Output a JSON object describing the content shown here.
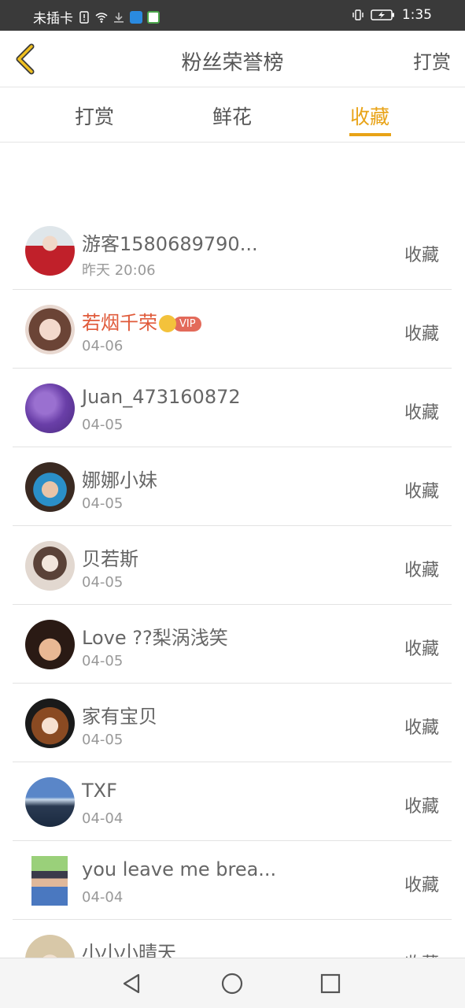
{
  "status_bar": {
    "carrier": "未插卡",
    "time": "1:35",
    "icons": [
      "sim-alert-icon",
      "wifi-icon",
      "download-icon",
      "app-icon",
      "app-icon",
      "vibrate-icon",
      "battery-charging-icon"
    ]
  },
  "header": {
    "title": "粉丝荣誉榜",
    "action_label": "打赏",
    "back_icon": "chevron-left-icon"
  },
  "tabs": [
    {
      "label": "打赏",
      "active": false
    },
    {
      "label": "鲜花",
      "active": false
    },
    {
      "label": "收藏",
      "active": true
    }
  ],
  "accent_color": "#e8a317",
  "vip_name_color": "#e05a3a",
  "list": [
    {
      "name": "游客1580689790...",
      "date": "昨天 20:06",
      "action": "收藏",
      "vip": false
    },
    {
      "name": "若烟千荣",
      "date": "04-06",
      "action": "收藏",
      "vip": true,
      "badge": "VIP"
    },
    {
      "name": "Juan_473160872",
      "date": "04-05",
      "action": "收藏",
      "vip": false
    },
    {
      "name": "娜娜小妹",
      "date": "04-05",
      "action": "收藏",
      "vip": false
    },
    {
      "name": "贝若斯",
      "date": "04-05",
      "action": "收藏",
      "vip": false
    },
    {
      "name": "Love ??梨涡浅笑",
      "date": "04-05",
      "action": "收藏",
      "vip": false
    },
    {
      "name": "家有宝贝",
      "date": "04-05",
      "action": "收藏",
      "vip": false
    },
    {
      "name": "TXF",
      "date": "04-04",
      "action": "收藏",
      "vip": false
    },
    {
      "name": "you leave me brea...",
      "date": "04-04",
      "action": "收藏",
      "vip": false
    },
    {
      "name": "小小小晴天",
      "date": "",
      "action": "收藏",
      "vip": false
    }
  ],
  "nav": [
    "back-triangle-icon",
    "home-circle-icon",
    "recents-square-icon"
  ]
}
